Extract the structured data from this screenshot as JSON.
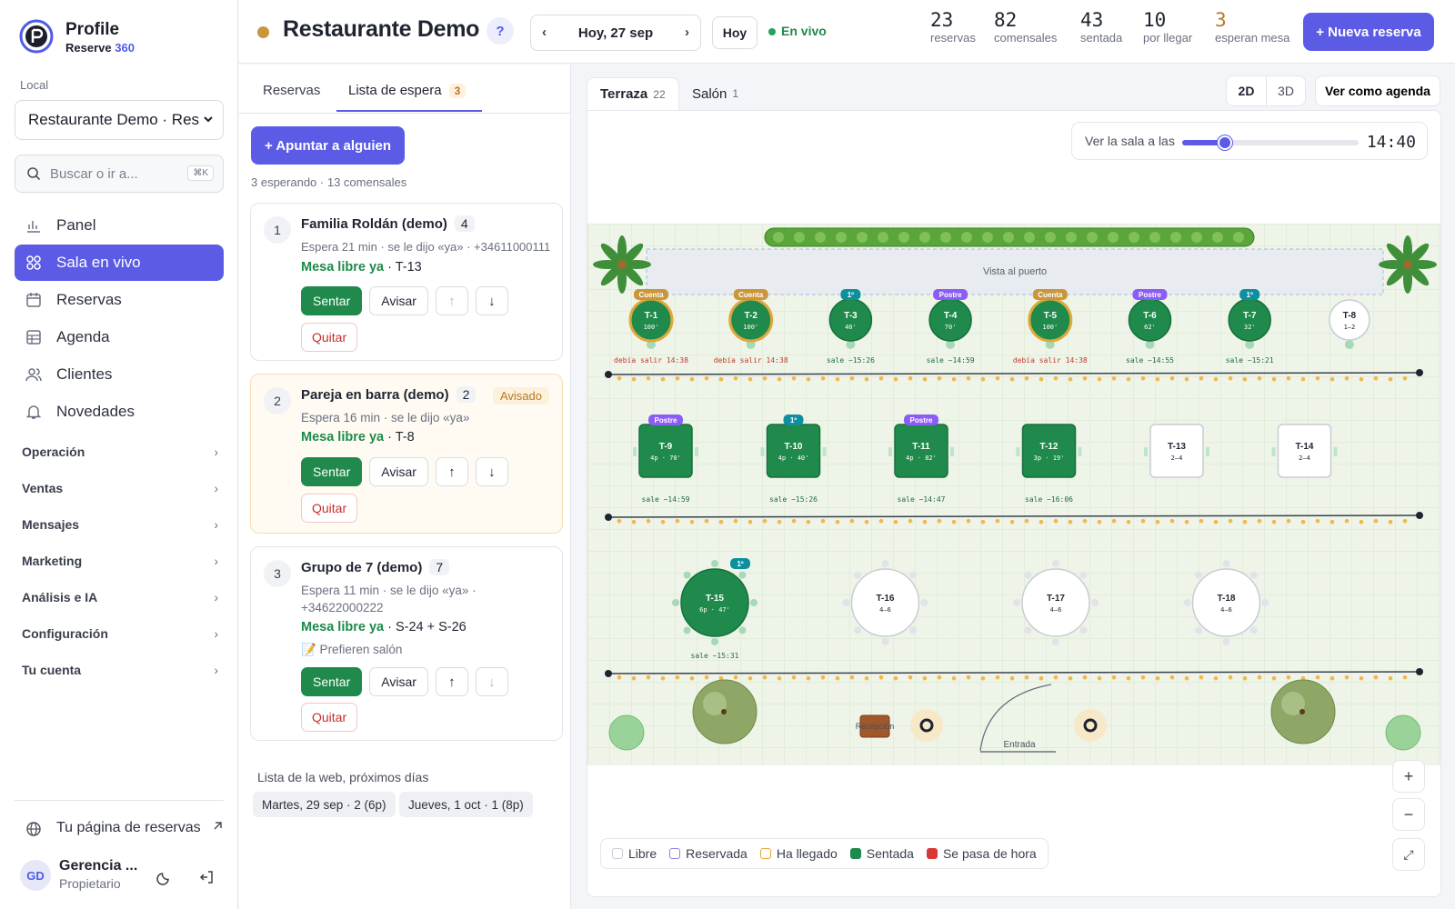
{
  "sidebar": {
    "brand_name": "Profile",
    "brand_sub_a": "Reserve",
    "brand_sub_b": "360",
    "local_label": "Local",
    "local_value": "Restaurante Demo · Res",
    "search_placeholder": "Buscar o ir a...",
    "search_shortcut": "⌘K",
    "nav": [
      {
        "label": "Panel",
        "icon": "bar-chart-icon",
        "active": false
      },
      {
        "label": "Sala en vivo",
        "icon": "grid-icon",
        "active": true
      },
      {
        "label": "Reservas",
        "icon": "calendar-icon",
        "active": false
      },
      {
        "label": "Agenda",
        "icon": "table-icon",
        "active": false
      },
      {
        "label": "Clientes",
        "icon": "users-icon",
        "active": false
      },
      {
        "label": "Novedades",
        "icon": "bell-icon",
        "active": false
      }
    ],
    "groups": [
      "Operación",
      "Ventas",
      "Mensajes",
      "Marketing",
      "Análisis e IA",
      "Configuración",
      "Tu cuenta"
    ],
    "my_page": "Tu página de reservas",
    "user_initials": "GD",
    "user_name": "Gerencia ...",
    "user_role": "Propietario"
  },
  "topbar": {
    "title": "Restaurante Demo",
    "help": "?",
    "date": "Hoy, 27 sep",
    "prev": "‹",
    "next": "›",
    "today_btn": "Hoy",
    "live": "En vivo",
    "stats": [
      {
        "value": "23",
        "label": "reservas",
        "color": "#1f2430"
      },
      {
        "value": "82",
        "label": "comensales",
        "color": "#1f2430"
      },
      {
        "value": "43",
        "label": "sentada",
        "color": "#1f2430"
      },
      {
        "value": "10",
        "label": "por llegar",
        "color": "#1f2430"
      },
      {
        "value": "3",
        "label": "esperan mesa",
        "color": "#b7791f"
      }
    ],
    "new_button": "+ Nueva reserva"
  },
  "waitlist": {
    "tab_reservas": "Reservas",
    "tab_lista": "Lista de espera",
    "tab_lista_count": "3",
    "add_button": "+ Apuntar a alguien",
    "summary": "3 esperando · 13 comensales",
    "free_label": "Mesa libre ya",
    "btn_sentar": "Sentar",
    "btn_avisar": "Avisar",
    "btn_quitar": "Quitar",
    "entries": [
      {
        "pos": "1",
        "name": "Familia Roldán (demo)",
        "size": "4",
        "status": "",
        "meta": "Espera 21 min · se le dijo «ya» · +34611000111",
        "table": "· T-13",
        "note": ""
      },
      {
        "pos": "2",
        "name": "Pareja en barra (demo)",
        "size": "2",
        "status": "Avisado",
        "meta": "Espera 16 min · se le dijo «ya»",
        "table": "· T-8",
        "note": ""
      },
      {
        "pos": "3",
        "name": "Grupo de 7 (demo)",
        "size": "7",
        "status": "",
        "meta": "Espera 11 min · se le dijo «ya» · +34622000222",
        "table": "· S-24 + S-26",
        "note": "📝 Prefieren salón"
      }
    ],
    "web_title": "Lista de la web, próximos días",
    "web_chips": [
      "Martes, 29 sep · 2 (6p)",
      "Jueves, 1 oct · 1 (8p)"
    ]
  },
  "map": {
    "tabs": [
      {
        "label": "Terraza",
        "count": "22",
        "active": true
      },
      {
        "label": "Salón",
        "count": "1",
        "active": false
      }
    ],
    "view_2d": "2D",
    "view_3d": "3D",
    "agenda_button": "Ver como agenda",
    "time_label": "Ver la sala a las",
    "time_value": "14:40",
    "time_slider_fraction": 0.24,
    "port_view": "Vista al puerto",
    "reception": "Recepción",
    "entrance": "Entrada",
    "zoom_in": "+",
    "zoom_out": "−",
    "fit": "⤢",
    "legend": [
      {
        "label": "Libre",
        "color": "#ffffff",
        "border": "#c9ccd4"
      },
      {
        "label": "Reservada",
        "color": "#ffffff",
        "border": "#8b83e6"
      },
      {
        "label": "Ha llegado",
        "color": "#ffffff",
        "border": "#e0a83a"
      },
      {
        "label": "Sentada",
        "color": "#1f8a4c",
        "border": "#1f8a4c"
      },
      {
        "label": "Se pasa de hora",
        "color": "#d93636",
        "border": "#d93636"
      }
    ],
    "tables_row1": [
      {
        "id": "T-1",
        "sub": "100'",
        "tag": "Cuenta",
        "note": "debía salir 14:38",
        "state": "over"
      },
      {
        "id": "T-2",
        "sub": "100'",
        "tag": "Cuenta",
        "note": "debía salir 14:38",
        "state": "over"
      },
      {
        "id": "T-3",
        "sub": "40'",
        "tag": "1º",
        "note": "sale ~15:26",
        "state": "seated"
      },
      {
        "id": "T-4",
        "sub": "70'",
        "tag": "Postre",
        "note": "sale ~14:59",
        "state": "seated"
      },
      {
        "id": "T-5",
        "sub": "100'",
        "tag": "Cuenta",
        "note": "debía salir 14:38",
        "state": "over"
      },
      {
        "id": "T-6",
        "sub": "62'",
        "tag": "Postre",
        "note": "sale ~14:55",
        "state": "seated"
      },
      {
        "id": "T-7",
        "sub": "32'",
        "tag": "1º",
        "note": "sale ~15:21",
        "state": "seated"
      },
      {
        "id": "T-8",
        "sub": "1–2",
        "tag": "",
        "note": "",
        "state": "free"
      }
    ],
    "tables_row2": [
      {
        "id": "T-9",
        "sub": "4p · 70'",
        "tag": "Postre",
        "note": "sale ~14:59",
        "state": "seated"
      },
      {
        "id": "T-10",
        "sub": "4p · 40'",
        "tag": "1º",
        "note": "sale ~15:26",
        "state": "seated"
      },
      {
        "id": "T-11",
        "sub": "4p · 82'",
        "tag": "Postre",
        "note": "sale ~14:47",
        "state": "seated"
      },
      {
        "id": "T-12",
        "sub": "3p · 19'",
        "tag": "",
        "note": "sale ~16:06",
        "state": "seated"
      },
      {
        "id": "T-13",
        "sub": "2–4",
        "tag": "",
        "note": "",
        "state": "free"
      },
      {
        "id": "T-14",
        "sub": "2–4",
        "tag": "",
        "note": "",
        "state": "free"
      }
    ],
    "tables_row3": [
      {
        "id": "T-15",
        "sub": "6p · 47'",
        "tag": "1º",
        "note": "sale ~15:31",
        "state": "seated"
      },
      {
        "id": "T-16",
        "sub": "4–6",
        "tag": "",
        "note": "",
        "state": "free"
      },
      {
        "id": "T-17",
        "sub": "4–6",
        "tag": "",
        "note": "",
        "state": "free"
      },
      {
        "id": "T-18",
        "sub": "4–6",
        "tag": "",
        "note": "",
        "state": "free"
      }
    ],
    "tag_colors": {
      "Cuenta": "#c9963b",
      "Postre": "#8b5cf6",
      "1º": "#0e8f9e"
    }
  }
}
